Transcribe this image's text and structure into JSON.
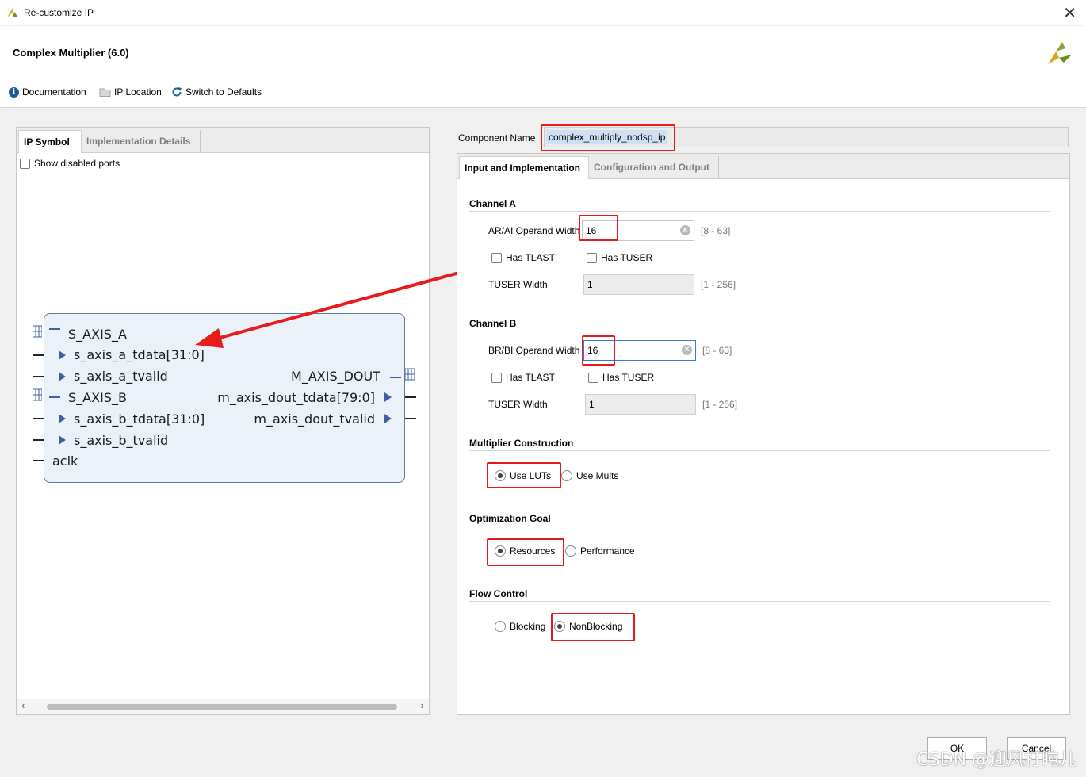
{
  "window": {
    "title": "Re-customize IP"
  },
  "header": {
    "ip_title": "Complex Multiplier (6.0)"
  },
  "toolbar": {
    "documentation": "Documentation",
    "ip_location": "IP Location",
    "switch_defaults": "Switch to Defaults"
  },
  "left": {
    "tabs": [
      "IP Symbol",
      "Implementation Details"
    ],
    "show_disabled_ports": "Show disabled ports",
    "ports_left": [
      "S_AXIS_A",
      "s_axis_a_tdata[31:0]",
      "s_axis_a_tvalid",
      "S_AXIS_B",
      "s_axis_b_tdata[31:0]",
      "s_axis_b_tvalid",
      "aclk"
    ],
    "ports_right": [
      "M_AXIS_DOUT",
      "m_axis_dout_tdata[79:0]",
      "m_axis_dout_tvalid"
    ]
  },
  "right": {
    "component_name_label": "Component Name",
    "component_name_value": "complex_multiply_nodsp_ip",
    "tabs": [
      "Input and Implementation",
      "Configuration and Output"
    ],
    "channel_a": {
      "title": "Channel A",
      "operand_label": "AR/AI Operand Width",
      "operand_value": "16",
      "operand_range": "[8 - 63]",
      "has_tlast": "Has TLAST",
      "has_tuser": "Has TUSER",
      "tuser_label": "TUSER Width",
      "tuser_value": "1",
      "tuser_range": "[1 - 256]"
    },
    "channel_b": {
      "title": "Channel B",
      "operand_label": "BR/BI Operand Width",
      "operand_value": "16",
      "operand_range": "[8 - 63]",
      "has_tlast": "Has TLAST",
      "has_tuser": "Has TUSER",
      "tuser_label": "TUSER Width",
      "tuser_value": "1",
      "tuser_range": "[1 - 256]"
    },
    "multiplier": {
      "title": "Multiplier Construction",
      "opt1": "Use LUTs",
      "opt2": "Use Mults",
      "selected": "Use LUTs"
    },
    "optimization": {
      "title": "Optimization Goal",
      "opt1": "Resources",
      "opt2": "Performance",
      "selected": "Resources"
    },
    "flow": {
      "title": "Flow Control",
      "opt1": "Blocking",
      "opt2": "NonBlocking",
      "selected": "NonBlocking"
    }
  },
  "buttons": {
    "ok": "OK",
    "cancel": "Cancel"
  },
  "watermark": "CSDN @迎风打盹儿",
  "colors": {
    "highlight": "#e81a1a",
    "ip_block_fill": "#eaf1f9",
    "ip_block_border": "#587aa3",
    "accent_blue": "#1e5b9a"
  }
}
